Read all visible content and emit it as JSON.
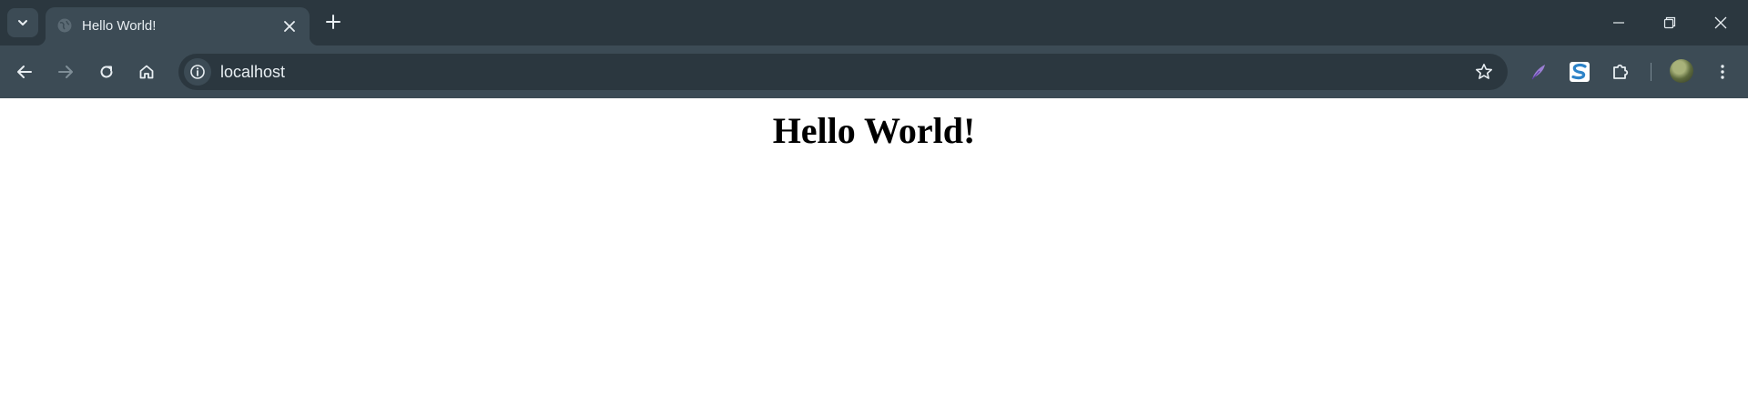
{
  "browser": {
    "tab": {
      "title": "Hello World!"
    },
    "omnibox": {
      "url": "localhost"
    },
    "icons": {
      "tab_search": "chevron-down-icon",
      "favicon": "globe-icon",
      "tab_close": "close-icon",
      "new_tab": "plus-icon",
      "minimize": "minimize-icon",
      "restore": "restore-icon",
      "close_window": "close-icon",
      "back": "arrow-left-icon",
      "forward": "arrow-right-icon",
      "reload": "reload-icon",
      "home": "home-icon",
      "site_info": "info-icon",
      "bookmark": "star-icon",
      "extension_1": "quill-extension-icon",
      "extension_2": "s-extension-icon",
      "extensions_menu": "puzzle-icon",
      "profile": "avatar",
      "menu": "kebab-menu-icon"
    },
    "colors": {
      "tabstrip": "#2b373f",
      "toolbar": "#3c4b55",
      "omnibox": "#2b373f",
      "icon": "#e8eef2"
    }
  },
  "page": {
    "heading": "Hello World!"
  }
}
